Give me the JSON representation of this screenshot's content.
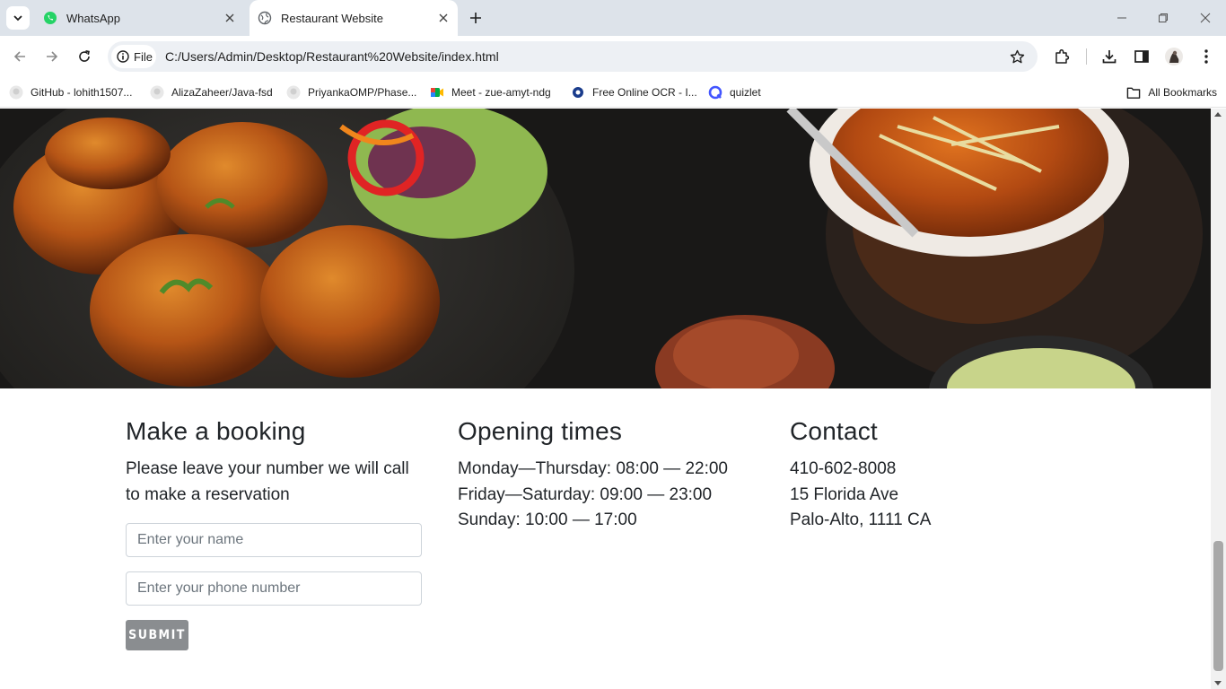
{
  "browser": {
    "tabs": [
      {
        "title": "WhatsApp",
        "active": false
      },
      {
        "title": "Restaurant Website",
        "active": true
      }
    ],
    "site_chip": "File",
    "url": "C:/Users/Admin/Desktop/Restaurant%20Website/index.html",
    "bookmarks": [
      "GitHub - lohith1507...",
      "AlizaZaheer/Java-fsd",
      "PriyankaOMP/Phase...",
      "Meet - zue-amyt-ndg",
      "Free Online OCR - I...",
      "quizlet"
    ],
    "all_bookmarks": "All Bookmarks"
  },
  "booking": {
    "title": "Make a booking",
    "text": "Please leave your number we will call to make a reservation",
    "name_placeholder": "Enter your name",
    "phone_placeholder": "Enter your phone number",
    "submit_label": "SUBMIT"
  },
  "hours": {
    "title": "Opening times",
    "lines": [
      "Monday—Thursday: 08:00 — 22:00",
      "Friday—Saturday: 09:00 — 23:00",
      "Sunday: 10:00 — 17:00"
    ]
  },
  "contact": {
    "title": "Contact",
    "lines": [
      "410-602-8008",
      "15 Florida Ave",
      "Palo-Alto, 1111 CA"
    ]
  },
  "colors": {
    "tabstrip": "#dde3ea",
    "submit_bg": "#8a8d90",
    "text": "#212529"
  }
}
